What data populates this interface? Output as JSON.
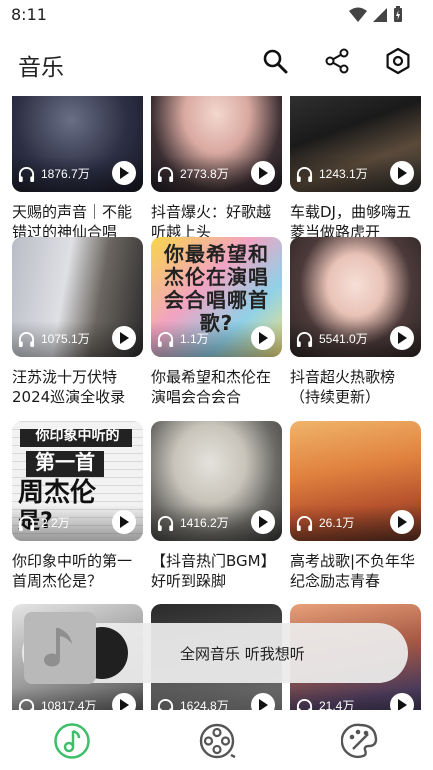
{
  "status": {
    "time": "8:11"
  },
  "app_bar": {
    "title": "音乐"
  },
  "cards": [
    {
      "count": "1876.7万",
      "title": "天赐的声音｜不能错过的神仙合唱"
    },
    {
      "count": "2773.8万",
      "title": "抖音爆火：好歌越听越上头"
    },
    {
      "count": "1243.1万",
      "title": "车载DJ，曲够嗨五菱当做路虎开"
    },
    {
      "count": "1075.1万",
      "title": "汪苏泷十万伏特2024巡演全收录"
    },
    {
      "count": "1.1万",
      "title": "你最希望和杰伦在演唱会合会合",
      "art_text": "你最希望和杰伦在演唱会合唱哪首歌?"
    },
    {
      "count": "5541.0万",
      "title": "抖音超火热歌榜（持续更新）"
    },
    {
      "count": "2.2万",
      "title": "你印象中听的第一首周杰伦是？",
      "art_text_1": "你印象中听的",
      "art_text_2": "第一首",
      "art_text_3": "周杰伦",
      "art_text_4": "是?"
    },
    {
      "count": "1416.2万",
      "title": "【抖音热门BGM】好听到跺脚"
    },
    {
      "count": "26.1万",
      "title": "高考战歌|不负年华纪念励志青春"
    },
    {
      "count": "10817.4万",
      "title": ""
    },
    {
      "count": "1624.8万",
      "title": ""
    },
    {
      "count": "21.4万",
      "title": ""
    }
  ],
  "toast": {
    "text": "全网音乐 听我想听"
  },
  "colors": {
    "accent": "#3dbf6a",
    "nav_inactive": "#555555"
  },
  "icons": [
    "search-icon",
    "share-icon",
    "settings-icon",
    "headphone-icon",
    "play-icon",
    "music-note-icon",
    "film-reel-icon",
    "palette-icon"
  ]
}
